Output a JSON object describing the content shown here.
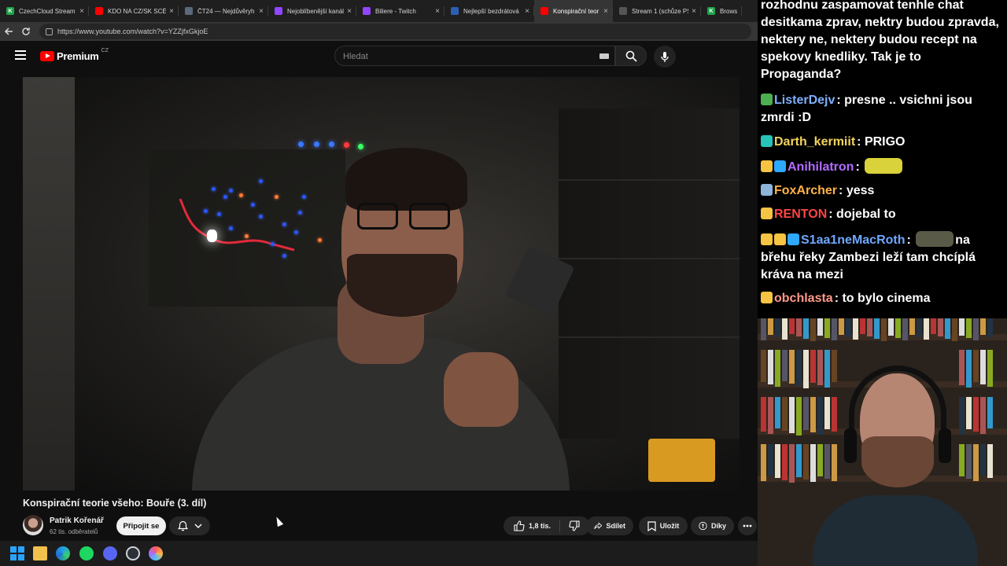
{
  "browser": {
    "tabs": [
      {
        "label": "CzechCloud Stream",
        "color": "#1fa34a",
        "glyph": "K",
        "active": false
      },
      {
        "label": "KDO NA CZ/SK SCÉN",
        "color": "#ff0000",
        "glyph": "",
        "active": false
      },
      {
        "label": "ČT24 — Nejdůvěryh",
        "color": "#5a6a7a",
        "glyph": "",
        "active": false
      },
      {
        "label": "Nejoblíbenější kanály",
        "color": "#9146ff",
        "glyph": "",
        "active": false
      },
      {
        "label": "Biliere - Twitch",
        "color": "#9146ff",
        "glyph": "",
        "active": false
      },
      {
        "label": "Nejlepší bezdrátová",
        "color": "#2b5fb3",
        "glyph": "",
        "active": false
      },
      {
        "label": "Konspirační teor",
        "color": "#ff0000",
        "glyph": "",
        "active": true
      },
      {
        "label": "Stream 1 (schůze PS)",
        "color": "#555555",
        "glyph": "",
        "active": false
      },
      {
        "label": "Browse -",
        "color": "#1fa34a",
        "glyph": "K",
        "active": false
      }
    ],
    "url": "https://www.youtube.com/watch?v=YZZjfxGkjoE"
  },
  "youtube": {
    "logo_text": "Premium",
    "country_code": "CZ",
    "search_placeholder": "Hledat",
    "video_title": "Konspirační teorie všeho: Bouře (3. díl)",
    "channel_name": "Patrik Kořenář",
    "subscribers": "62 tis. odběratelů",
    "join_label": "Připojit se",
    "like_count": "1,8 tis.",
    "share_label": "Sdílet",
    "save_label": "Uložit",
    "thanks_label": "Díky"
  },
  "chat": {
    "messages": [
      {
        "user": "",
        "text": "rozhodnu zaspamovat tenhle chat desitkama zprav, nektry budou zpravda, nektery ne, nektery budou recept na spekovy knedliky. Tak je to Propaganda?",
        "color": "#ffffff",
        "badges": []
      },
      {
        "user": "ListerDejv",
        "text": "presne .. vsichni jsou zmrdi :D",
        "color": "#7fb0ff",
        "badges": [
          "#4caf50"
        ]
      },
      {
        "user": "Darth_kermiit",
        "text": "PRIGO",
        "color": "#f4d35e",
        "badges": [
          "#27c3b8"
        ]
      },
      {
        "user": "Anihilatron",
        "text": "",
        "color": "#b46cff",
        "badges": [
          "#f6c343",
          "#2fa8ff"
        ],
        "emote": "#d9d23a"
      },
      {
        "user": "FoxArcher",
        "text": "yess",
        "color": "#ffb347",
        "badges": [
          "#8db4d9"
        ]
      },
      {
        "user": "RENTON",
        "text": "dojebal to",
        "color": "#ff4545",
        "badges": [
          "#f6c343"
        ]
      },
      {
        "user": "S1aa1neMacRoth",
        "text": "na břehu řeky Zambezi leží tam chcíplá kráva na mezi",
        "color": "#6fa8ff",
        "badges": [
          "#f6c343",
          "#f6c343",
          "#2fa8ff"
        ],
        "emote": "#5a5a48"
      },
      {
        "user": "obchlasta",
        "text": "to bylo cinema",
        "color": "#ff9a8a",
        "badges": [
          "#f6c343"
        ]
      }
    ]
  },
  "icons": {
    "back": "arrow-left-icon",
    "reload": "reload-icon",
    "menu": "hamburger-menu-icon",
    "search": "search-icon",
    "mic": "microphone-icon",
    "bell": "bell-icon",
    "like": "thumbs-up-icon",
    "dislike": "thumbs-down-icon",
    "share": "share-icon",
    "save": "save-icon",
    "thanks": "thanks-icon",
    "more": "more-icon"
  }
}
